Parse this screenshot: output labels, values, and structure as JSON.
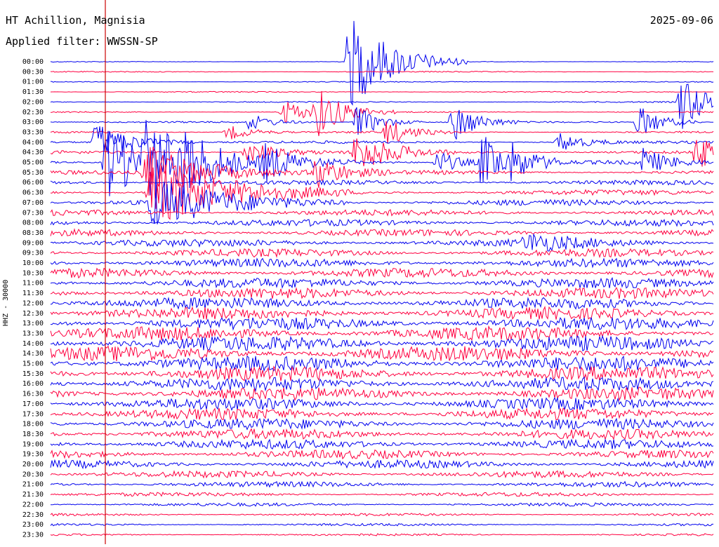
{
  "header": {
    "station": "HT Achillion, Magnisia",
    "filter": "Applied filter: WWSSN-SP",
    "date": "2025-09-06"
  },
  "channel_label": "HHZ - 30000",
  "colors": {
    "odd": "#0000ee",
    "even": "#ff0040",
    "marker": "#cc0000",
    "text": "#000000"
  },
  "chart_data": {
    "type": "line",
    "title": "HT Achillion, Magnisia",
    "subtitle": "Applied filter: WWSSN-SP",
    "ylabel": "HHZ - 30000",
    "xlabel": "",
    "tick_labels": [
      "00:00",
      "00:30",
      "01:00",
      "01:30",
      "02:00",
      "02:30",
      "03:00",
      "03:30",
      "04:00",
      "04:30",
      "05:00",
      "05:30",
      "06:00",
      "06:30",
      "07:00",
      "07:30",
      "08:00",
      "08:30",
      "09:00",
      "09:30",
      "10:00",
      "10:30",
      "11:00",
      "11:30",
      "12:00",
      "12:30",
      "13:00",
      "13:30",
      "14:00",
      "14:30",
      "15:00",
      "15:30",
      "16:00",
      "16:30",
      "17:00",
      "17:30",
      "18:00",
      "18:30",
      "19:00",
      "19:30",
      "20:00",
      "20:30",
      "21:00",
      "21:30",
      "22:00",
      "22:30",
      "23:00",
      "23:30"
    ],
    "trace_minutes": 30,
    "series_colors": [
      "#0000ee",
      "#ff0040"
    ],
    "noise_level": [
      0.6,
      0.8,
      0.7,
      0.8,
      0.9,
      1.0,
      1.2,
      1.5,
      2.0,
      2.5,
      3.0,
      3.0,
      3.5,
      4.0,
      4.5,
      4.5,
      5.0,
      5.0,
      5.5,
      6.0,
      6.5,
      7.0,
      7.5,
      8.0,
      8.5,
      9.0,
      9.5,
      10.0,
      11.0,
      11.0,
      11.0,
      10.5,
      10.0,
      9.5,
      9.0,
      8.5,
      8.0,
      7.5,
      7.0,
      6.5,
      6.0,
      5.0,
      4.0,
      3.0,
      2.5,
      2.0,
      1.8,
      1.6
    ],
    "events": [
      {
        "trace": 0,
        "minute": 13.5,
        "amplitude": 70,
        "duration": 1.8
      },
      {
        "trace": 4,
        "minute": 28.5,
        "amplitude": 45,
        "duration": 1.0
      },
      {
        "trace": 5,
        "minute": 10.5,
        "amplitude": 20,
        "duration": 1.0
      },
      {
        "trace": 5,
        "minute": 12.0,
        "amplitude": 35,
        "duration": 1.2
      },
      {
        "trace": 6,
        "minute": 9.0,
        "amplitude": 12,
        "duration": 1.0
      },
      {
        "trace": 6,
        "minute": 13.8,
        "amplitude": 25,
        "duration": 1.0
      },
      {
        "trace": 6,
        "minute": 18.2,
        "amplitude": 30,
        "duration": 1.0
      },
      {
        "trace": 6,
        "minute": 26.6,
        "amplitude": 25,
        "duration": 1.0
      },
      {
        "trace": 7,
        "minute": 8.0,
        "amplitude": 12,
        "duration": 1.0
      },
      {
        "trace": 7,
        "minute": 15.2,
        "amplitude": 20,
        "duration": 1.0
      },
      {
        "trace": 8,
        "minute": 2.0,
        "amplitude": 30,
        "duration": 1.5
      },
      {
        "trace": 8,
        "minute": 23.0,
        "amplitude": 15,
        "duration": 1.0
      },
      {
        "trace": 9,
        "minute": 8.8,
        "amplitude": 18,
        "duration": 1.2
      },
      {
        "trace": 9,
        "minute": 13.8,
        "amplitude": 30,
        "duration": 1.5
      },
      {
        "trace": 9,
        "minute": 29.2,
        "amplitude": 22,
        "duration": 1.5
      },
      {
        "trace": 10,
        "minute": 2.5,
        "amplitude": 55,
        "duration": 2.0
      },
      {
        "trace": 10,
        "minute": 4.2,
        "amplitude": 45,
        "duration": 2.2
      },
      {
        "trace": 10,
        "minute": 6.0,
        "amplitude": 30,
        "duration": 1.2
      },
      {
        "trace": 10,
        "minute": 9.6,
        "amplitude": 25,
        "duration": 1.4
      },
      {
        "trace": 10,
        "minute": 17.5,
        "amplitude": 18,
        "duration": 1.0
      },
      {
        "trace": 10,
        "minute": 19.5,
        "amplitude": 40,
        "duration": 1.2
      },
      {
        "trace": 10,
        "minute": 20.8,
        "amplitude": 18,
        "duration": 1.0
      },
      {
        "trace": 10,
        "minute": 26.8,
        "amplitude": 20,
        "duration": 1.0
      },
      {
        "trace": 11,
        "minute": 4.3,
        "amplitude": 40,
        "duration": 2.5
      },
      {
        "trace": 11,
        "minute": 12.0,
        "amplitude": 25,
        "duration": 1.2
      },
      {
        "trace": 13,
        "minute": 4.5,
        "amplitude": 50,
        "duration": 3.0
      },
      {
        "trace": 14,
        "minute": 4.5,
        "amplitude": 35,
        "duration": 3.0
      },
      {
        "trace": 18,
        "minute": 21.5,
        "amplitude": 12,
        "duration": 2.0
      }
    ]
  }
}
